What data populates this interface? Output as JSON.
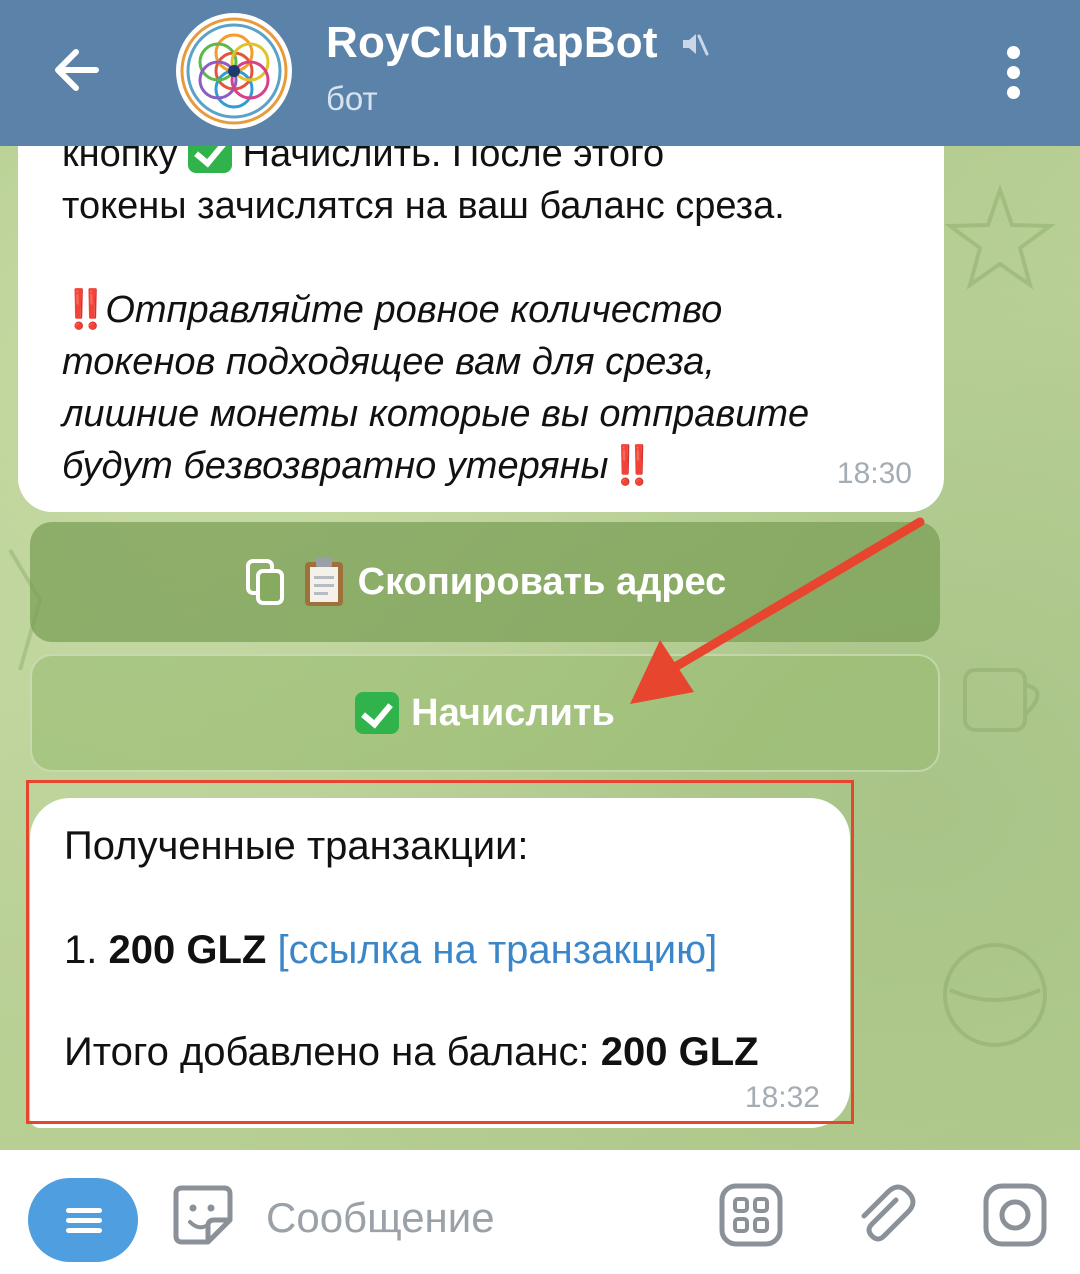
{
  "header": {
    "title": "RoyClubTapBot",
    "subtitle": "бот",
    "back_icon": "arrow-left-icon",
    "muted_icon": "speaker-muted-icon",
    "menu_icon": "more-vertical-icon",
    "color": "#5b82a8"
  },
  "messages": [
    {
      "lines": [
        {
          "before": "кнопку ",
          "after": " Начислить. После этого"
        },
        "токены зачислятся на ваш баланс среза."
      ],
      "warning": {
        "prefix": "‼️",
        "lines": [
          "Отправляйте ровное количество",
          "токенов подходящее вам для среза,",
          "лишние монеты которые вы отправите",
          "будут безвозвратно утеряны"
        ],
        "suffix": "‼️"
      },
      "time": "18:30"
    },
    {
      "heading": "Полученные транзакции:",
      "item_number": "1.",
      "item_amount": "200 GLZ",
      "item_link": "[ссылка на транзакцию]",
      "total_label": "Итого добавлено на баланс:",
      "total_value": "200 GLZ",
      "time": "18:32"
    }
  ],
  "inline_buttons": {
    "copy_address": "Скопировать адрес",
    "credit": "Начислить"
  },
  "input_bar": {
    "placeholder": "Сообщение",
    "menu_icon": "bot-menu-icon",
    "sticker_icon": "sticker-icon",
    "commands_icon": "bot-commands-icon",
    "attach_icon": "paperclip-icon",
    "camera_icon": "camera-icon"
  },
  "colors": {
    "link": "#3a86c8",
    "annotation_red": "#e8452e",
    "accent_blue": "#4f9ee0",
    "check_green": "#2fb34a"
  }
}
